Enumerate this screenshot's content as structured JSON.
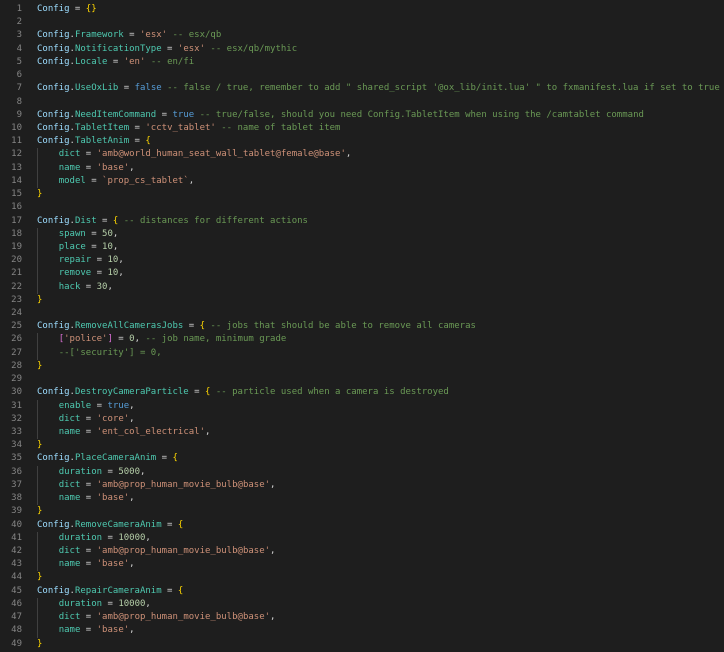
{
  "editor": {
    "language": "lua",
    "colors": {
      "background": "#1e1e1e",
      "variable": "#9cdcfe",
      "property": "#4ec9b0",
      "string": "#ce9178",
      "comment": "#6a9955",
      "keyword": "#569cd6",
      "number": "#b5cea8",
      "brace": "#ffd700",
      "bracket": "#da70d6"
    },
    "lines": [
      [
        [
          "v",
          "Config"
        ],
        [
          "o",
          " = "
        ],
        [
          "b1",
          "{}"
        ]
      ],
      [],
      [
        [
          "v",
          "Config"
        ],
        [
          "o",
          "."
        ],
        [
          "p",
          "Framework"
        ],
        [
          "o",
          " = "
        ],
        [
          "s",
          "'esx'"
        ],
        [
          "c",
          " -- esx/qb"
        ]
      ],
      [
        [
          "v",
          "Config"
        ],
        [
          "o",
          "."
        ],
        [
          "p",
          "NotificationType"
        ],
        [
          "o",
          " = "
        ],
        [
          "s",
          "'esx'"
        ],
        [
          "c",
          " -- esx/qb/mythic"
        ]
      ],
      [
        [
          "v",
          "Config"
        ],
        [
          "o",
          "."
        ],
        [
          "p",
          "Locale"
        ],
        [
          "o",
          " = "
        ],
        [
          "s",
          "'en'"
        ],
        [
          "c",
          " -- en/fi"
        ]
      ],
      [],
      [
        [
          "v",
          "Config"
        ],
        [
          "o",
          "."
        ],
        [
          "p",
          "UseOxLib"
        ],
        [
          "o",
          " = "
        ],
        [
          "k",
          "false"
        ],
        [
          "c",
          " -- false / true, remember to add \" shared_script '@ox_lib/init.lua' \" to fxmanifest.lua if set to true"
        ]
      ],
      [],
      [
        [
          "v",
          "Config"
        ],
        [
          "o",
          "."
        ],
        [
          "p",
          "NeedItemCommand"
        ],
        [
          "o",
          " = "
        ],
        [
          "k",
          "true"
        ],
        [
          "c",
          " -- true/false, should you need Config.TabletItem when using the /camtablet command"
        ]
      ],
      [
        [
          "v",
          "Config"
        ],
        [
          "o",
          "."
        ],
        [
          "p",
          "TabletItem"
        ],
        [
          "o",
          " = "
        ],
        [
          "s",
          "'cctv_tablet'"
        ],
        [
          "c",
          " -- name of tablet item"
        ]
      ],
      [
        [
          "v",
          "Config"
        ],
        [
          "o",
          "."
        ],
        [
          "p",
          "TabletAnim"
        ],
        [
          "o",
          " = "
        ],
        [
          "b1",
          "{"
        ]
      ],
      [
        [
          "i",
          ""
        ],
        [
          "p",
          "dict"
        ],
        [
          "o",
          " = "
        ],
        [
          "s",
          "'amb@world_human_seat_wall_tablet@female@base'"
        ],
        [
          "o",
          ","
        ]
      ],
      [
        [
          "i",
          ""
        ],
        [
          "p",
          "name"
        ],
        [
          "o",
          " = "
        ],
        [
          "s",
          "'base'"
        ],
        [
          "o",
          ","
        ]
      ],
      [
        [
          "i",
          ""
        ],
        [
          "p",
          "model"
        ],
        [
          "o",
          " = "
        ],
        [
          "s",
          "`prop_cs_tablet`"
        ],
        [
          "o",
          ","
        ]
      ],
      [
        [
          "b1",
          "}"
        ]
      ],
      [],
      [
        [
          "v",
          "Config"
        ],
        [
          "o",
          "."
        ],
        [
          "p",
          "Dist"
        ],
        [
          "o",
          " = "
        ],
        [
          "b1",
          "{"
        ],
        [
          "c",
          " -- distances for different actions"
        ]
      ],
      [
        [
          "i",
          ""
        ],
        [
          "p",
          "spawn"
        ],
        [
          "o",
          " = "
        ],
        [
          "n",
          "50"
        ],
        [
          "o",
          ","
        ]
      ],
      [
        [
          "i",
          ""
        ],
        [
          "p",
          "place"
        ],
        [
          "o",
          " = "
        ],
        [
          "n",
          "10"
        ],
        [
          "o",
          ","
        ]
      ],
      [
        [
          "i",
          ""
        ],
        [
          "p",
          "repair"
        ],
        [
          "o",
          " = "
        ],
        [
          "n",
          "10"
        ],
        [
          "o",
          ","
        ]
      ],
      [
        [
          "i",
          ""
        ],
        [
          "p",
          "remove"
        ],
        [
          "o",
          " = "
        ],
        [
          "n",
          "10"
        ],
        [
          "o",
          ","
        ]
      ],
      [
        [
          "i",
          ""
        ],
        [
          "p",
          "hack"
        ],
        [
          "o",
          " = "
        ],
        [
          "n",
          "30"
        ],
        [
          "o",
          ","
        ]
      ],
      [
        [
          "b1",
          "}"
        ]
      ],
      [],
      [
        [
          "v",
          "Config"
        ],
        [
          "o",
          "."
        ],
        [
          "p",
          "RemoveAllCamerasJobs"
        ],
        [
          "o",
          " = "
        ],
        [
          "b1",
          "{"
        ],
        [
          "c",
          " -- jobs that should be able to remove all cameras"
        ]
      ],
      [
        [
          "i",
          ""
        ],
        [
          "b2",
          "["
        ],
        [
          "s",
          "'police'"
        ],
        [
          "b2",
          "]"
        ],
        [
          "o",
          " = "
        ],
        [
          "n",
          "0"
        ],
        [
          "o",
          ","
        ],
        [
          "c",
          " -- job name, minimum grade"
        ]
      ],
      [
        [
          "i",
          ""
        ],
        [
          "c",
          "--['security'] = 0,"
        ]
      ],
      [
        [
          "b1",
          "}"
        ]
      ],
      [],
      [
        [
          "v",
          "Config"
        ],
        [
          "o",
          "."
        ],
        [
          "p",
          "DestroyCameraParticle"
        ],
        [
          "o",
          " = "
        ],
        [
          "b1",
          "{"
        ],
        [
          "c",
          " -- particle used when a camera is destroyed"
        ]
      ],
      [
        [
          "i",
          ""
        ],
        [
          "p",
          "enable"
        ],
        [
          "o",
          " = "
        ],
        [
          "k",
          "true"
        ],
        [
          "o",
          ","
        ]
      ],
      [
        [
          "i",
          ""
        ],
        [
          "p",
          "dict"
        ],
        [
          "o",
          " = "
        ],
        [
          "s",
          "'core'"
        ],
        [
          "o",
          ","
        ]
      ],
      [
        [
          "i",
          ""
        ],
        [
          "p",
          "name"
        ],
        [
          "o",
          " = "
        ],
        [
          "s",
          "'ent_col_electrical'"
        ],
        [
          "o",
          ","
        ]
      ],
      [
        [
          "b1",
          "}"
        ]
      ],
      [
        [
          "v",
          "Config"
        ],
        [
          "o",
          "."
        ],
        [
          "p",
          "PlaceCameraAnim"
        ],
        [
          "o",
          " = "
        ],
        [
          "b1",
          "{"
        ]
      ],
      [
        [
          "i",
          ""
        ],
        [
          "p",
          "duration"
        ],
        [
          "o",
          " = "
        ],
        [
          "n",
          "5000"
        ],
        [
          "o",
          ","
        ]
      ],
      [
        [
          "i",
          ""
        ],
        [
          "p",
          "dict"
        ],
        [
          "o",
          " = "
        ],
        [
          "s",
          "'amb@prop_human_movie_bulb@base'"
        ],
        [
          "o",
          ","
        ]
      ],
      [
        [
          "i",
          ""
        ],
        [
          "p",
          "name"
        ],
        [
          "o",
          " = "
        ],
        [
          "s",
          "'base'"
        ],
        [
          "o",
          ","
        ]
      ],
      [
        [
          "b1",
          "}"
        ]
      ],
      [
        [
          "v",
          "Config"
        ],
        [
          "o",
          "."
        ],
        [
          "p",
          "RemoveCameraAnim"
        ],
        [
          "o",
          " = "
        ],
        [
          "b1",
          "{"
        ]
      ],
      [
        [
          "i",
          ""
        ],
        [
          "p",
          "duration"
        ],
        [
          "o",
          " = "
        ],
        [
          "n",
          "10000"
        ],
        [
          "o",
          ","
        ]
      ],
      [
        [
          "i",
          ""
        ],
        [
          "p",
          "dict"
        ],
        [
          "o",
          " = "
        ],
        [
          "s",
          "'amb@prop_human_movie_bulb@base'"
        ],
        [
          "o",
          ","
        ]
      ],
      [
        [
          "i",
          ""
        ],
        [
          "p",
          "name"
        ],
        [
          "o",
          " = "
        ],
        [
          "s",
          "'base'"
        ],
        [
          "o",
          ","
        ]
      ],
      [
        [
          "b1",
          "}"
        ]
      ],
      [
        [
          "v",
          "Config"
        ],
        [
          "o",
          "."
        ],
        [
          "p",
          "RepairCameraAnim"
        ],
        [
          "o",
          " = "
        ],
        [
          "b1",
          "{"
        ]
      ],
      [
        [
          "i",
          ""
        ],
        [
          "p",
          "duration"
        ],
        [
          "o",
          " = "
        ],
        [
          "n",
          "10000"
        ],
        [
          "o",
          ","
        ]
      ],
      [
        [
          "i",
          ""
        ],
        [
          "p",
          "dict"
        ],
        [
          "o",
          " = "
        ],
        [
          "s",
          "'amb@prop_human_movie_bulb@base'"
        ],
        [
          "o",
          ","
        ]
      ],
      [
        [
          "i",
          ""
        ],
        [
          "p",
          "name"
        ],
        [
          "o",
          " = "
        ],
        [
          "s",
          "'base'"
        ],
        [
          "o",
          ","
        ]
      ],
      [
        [
          "b1",
          "}"
        ]
      ]
    ]
  }
}
